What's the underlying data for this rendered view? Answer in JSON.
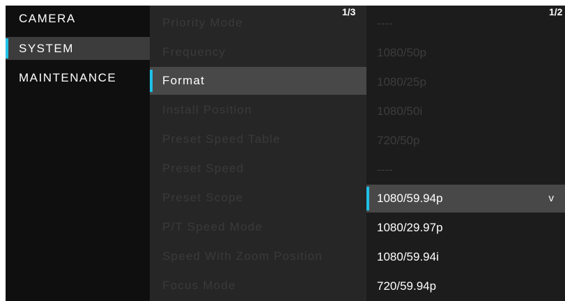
{
  "menu": {
    "items": [
      {
        "label": "CAMERA"
      },
      {
        "label": "SYSTEM"
      },
      {
        "label": "MAINTENANCE"
      }
    ]
  },
  "submenu": {
    "page": "1/3",
    "items": [
      {
        "label": "Priority Mode"
      },
      {
        "label": "Frequency"
      },
      {
        "label": "Format"
      },
      {
        "label": "Install Position"
      },
      {
        "label": "Preset Speed Table"
      },
      {
        "label": "Preset Speed"
      },
      {
        "label": "Preset Scope"
      },
      {
        "label": "P/T Speed Mode"
      },
      {
        "label": "Speed With Zoom Position"
      },
      {
        "label": "Focus Mode"
      }
    ]
  },
  "options": {
    "page": "1/2",
    "selected_indicator": "v",
    "items": [
      {
        "label": "----"
      },
      {
        "label": "1080/50p"
      },
      {
        "label": "1080/25p"
      },
      {
        "label": "1080/50i"
      },
      {
        "label": "720/50p"
      },
      {
        "label": "----"
      },
      {
        "label": "1080/59.94p"
      },
      {
        "label": "1080/29.97p"
      },
      {
        "label": "1080/59.94i"
      },
      {
        "label": "720/59.94p"
      }
    ]
  },
  "colors": {
    "accent": "#1fc0e6",
    "selected_bg": "#484848",
    "dim_text": "#3a3a3a"
  }
}
